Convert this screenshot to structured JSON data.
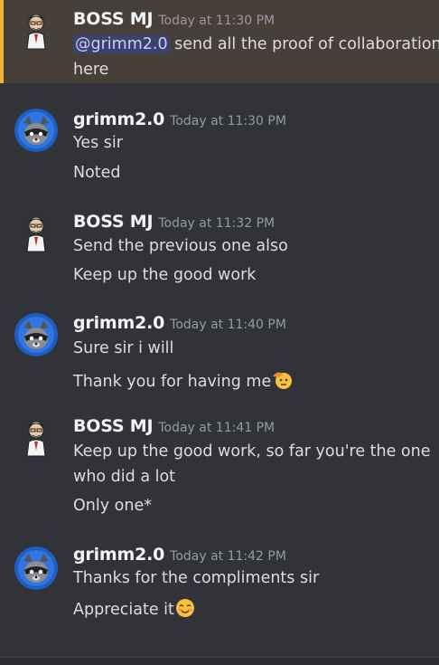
{
  "messages": [
    {
      "user": "BOSS MJ",
      "avatar": "professor-avatar",
      "time": "Today at 11:30 PM",
      "mention": "@grimm2.0",
      "lines": [
        "send all the proof of collaboration",
        "here"
      ]
    },
    {
      "user": "grimm2.0",
      "avatar": "raccoon-avatar",
      "time": "Today at 11:30 PM",
      "lines": [
        "Yes sir",
        "Noted"
      ]
    },
    {
      "user": "BOSS MJ",
      "avatar": "professor-avatar",
      "time": "Today at 11:32 PM",
      "lines": [
        "Send the previous one also",
        "Keep up the good work"
      ]
    },
    {
      "user": "grimm2.0",
      "avatar": "raccoon-avatar",
      "time": "Today at 11:40 PM",
      "lines": [
        "Sure sir i will",
        "Thank you for having me"
      ],
      "emoji": "saluting-face-emoji"
    },
    {
      "user": "BOSS MJ",
      "avatar": "professor-avatar",
      "time": "Today at 11:41 PM",
      "lines": [
        "Keep up the good work, so far you're the one",
        "who did a lot",
        "Only one*"
      ]
    },
    {
      "user": "grimm2.0",
      "avatar": "raccoon-avatar",
      "time": "Today at 11:42 PM",
      "lines": [
        "Thanks for the compliments sir",
        "Appreciate it"
      ],
      "emoji": "smiling-blushing-face-emoji"
    }
  ],
  "colors": {
    "background": "#313338",
    "highlight": "#47403a",
    "highlight_bar": "#f0b232",
    "mention_bg": "#3c4270",
    "timestamp": "#949ba4"
  }
}
